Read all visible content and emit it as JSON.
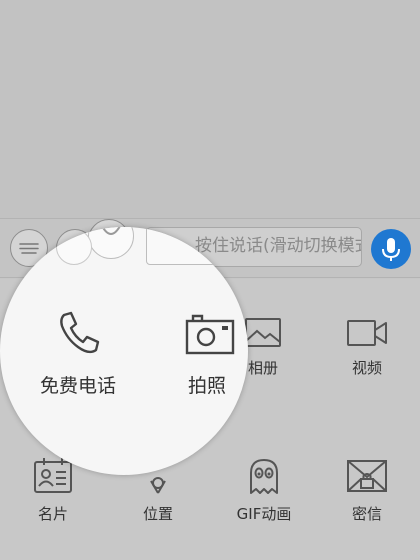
{
  "input_bar": {
    "placeholder_text": "按住说话(滑动切换模式)",
    "keyboard_icon": "keyboard-icon",
    "emoji_icon": "smiley-icon",
    "mic_icon": "microphone-icon",
    "mic_color": "#1f78d1"
  },
  "panel": {
    "items": [
      {
        "label": "免费电话",
        "icon": "phone-icon"
      },
      {
        "label": "拍照",
        "icon": "camera-icon"
      },
      {
        "label": "相册",
        "icon": "picture-icon"
      },
      {
        "label": "视频",
        "icon": "video-camera-icon"
      },
      {
        "label": "名片",
        "icon": "contact-card-icon"
      },
      {
        "label": "位置",
        "icon": "location-pin-icon"
      },
      {
        "label": "GIF动画",
        "icon": "ghost-icon"
      },
      {
        "label": "密信",
        "icon": "locked-envelope-icon"
      }
    ]
  }
}
